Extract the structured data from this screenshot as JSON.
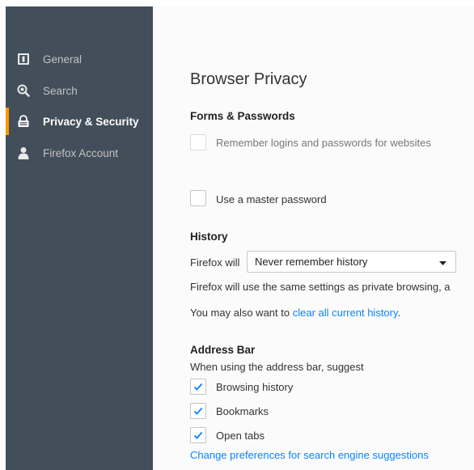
{
  "sidebar": {
    "items": [
      {
        "label": "General",
        "icon": "general-icon",
        "selected": false
      },
      {
        "label": "Search",
        "icon": "search-icon",
        "selected": false
      },
      {
        "label": "Privacy & Security",
        "icon": "lock-icon",
        "selected": true
      },
      {
        "label": "Firefox Account",
        "icon": "account-icon",
        "selected": false
      }
    ],
    "accent_color": "#ff9500",
    "background": "#424f5a"
  },
  "main": {
    "title": "Browser Privacy",
    "forms": {
      "heading": "Forms & Passwords",
      "remember_logins": {
        "label": "Remember logins and passwords for websites",
        "checked": false,
        "disabled": true
      },
      "master_password": {
        "label": "Use a master password",
        "checked": false
      }
    },
    "history": {
      "heading": "History",
      "prefix": "Firefox will",
      "mode": "Never remember history",
      "description": "Firefox will use the same settings as private browsing, a",
      "also_text": "You may also want to ",
      "clear_link": "clear all current history",
      "suffix": "."
    },
    "address_bar": {
      "heading": "Address Bar",
      "intro": "When using the address bar, suggest",
      "options": [
        {
          "label": "Browsing history",
          "checked": true
        },
        {
          "label": "Bookmarks",
          "checked": true
        },
        {
          "label": "Open tabs",
          "checked": true
        }
      ],
      "prefs_link": "Change preferences for search engine suggestions"
    },
    "link_color": "#0a84ff"
  }
}
